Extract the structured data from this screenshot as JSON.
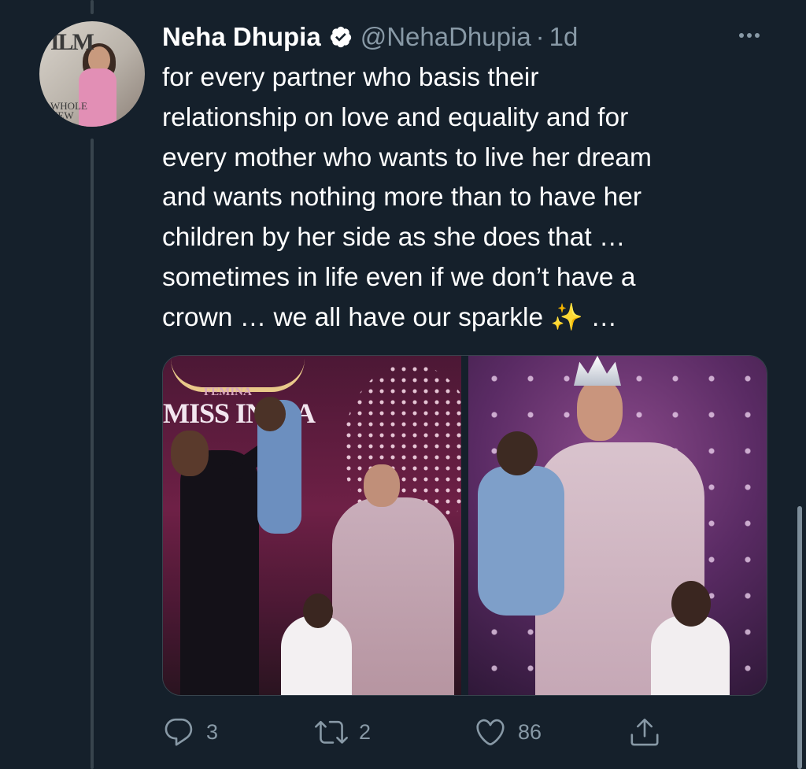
{
  "tweet": {
    "author_name": "Neha Dhupia",
    "handle": "@NehaDhupia",
    "separator": "·",
    "timestamp": "1d",
    "text_lines": [
      "for every partner who basis their",
      "relationship on love and equality and for",
      "every mother who wants to live her dream",
      "and wants nothing more than to have her",
      "children by her side as she does that …",
      "sometimes in life even if we don’t have a",
      "crown … we all have our sparkle"
    ],
    "sparkle_emoji": "✨",
    "trailing": " …",
    "avatar_text": {
      "magazine": "ILM",
      "cover_line": "WHOLE NEW"
    },
    "media_text": {
      "brand_small": "FEMINA",
      "brand_large": "MISS INDIA"
    },
    "actions": {
      "reply_count": "3",
      "retweet_count": "2",
      "like_count": "86"
    }
  },
  "icons": [
    "verified-badge-icon",
    "more-icon",
    "reply-icon",
    "retweet-icon",
    "like-icon",
    "share-icon"
  ],
  "colors": {
    "background": "#15202b",
    "secondary_text": "#8899a6",
    "divider": "#38444d"
  }
}
